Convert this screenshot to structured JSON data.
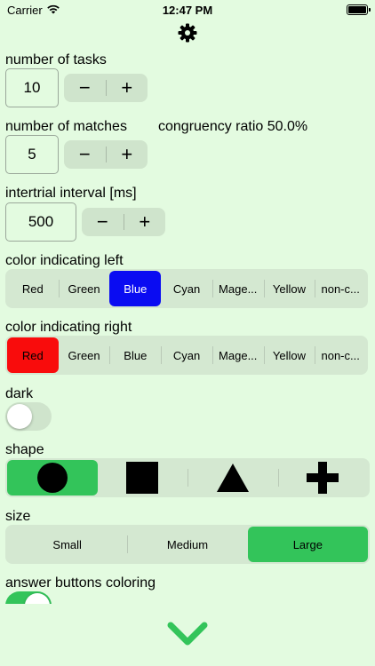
{
  "status_bar": {
    "carrier": "Carrier",
    "time": "12:47 PM"
  },
  "settings": {
    "tasks": {
      "label": "number of tasks",
      "value": "10"
    },
    "matches": {
      "label": "number of matches",
      "value": "5",
      "ratio": "congruency ratio 50.0%"
    },
    "interval": {
      "label": "intertrial interval [ms]",
      "value": "500"
    },
    "stepper": {
      "minus": "−",
      "plus": "+"
    },
    "left_color": {
      "label": "color indicating left",
      "options": [
        "Red",
        "Green",
        "Blue",
        "Cyan",
        "Mage...",
        "Yellow",
        "non-c..."
      ],
      "selected": "Blue"
    },
    "right_color": {
      "label": "color indicating right",
      "options": [
        "Red",
        "Green",
        "Blue",
        "Cyan",
        "Mage...",
        "Yellow",
        "non-c..."
      ],
      "selected": "Red"
    },
    "dark": {
      "label": "dark",
      "on": false
    },
    "shape": {
      "label": "shape",
      "options": [
        "circle-icon",
        "square-icon",
        "triangle-icon",
        "cross-icon"
      ],
      "selected": "circle-icon"
    },
    "size": {
      "label": "size",
      "options": [
        "Small",
        "Medium",
        "Large"
      ],
      "selected": "Large"
    },
    "answer_coloring": {
      "label": "answer buttons coloring",
      "on": true
    }
  },
  "icons": {
    "settings": "gear-icon",
    "next": "chevron-down-icon"
  },
  "colors": {
    "background": "#e3fbe0",
    "green": "#33c45a",
    "blue": "#0a0cf2",
    "red": "#f90c0c"
  }
}
